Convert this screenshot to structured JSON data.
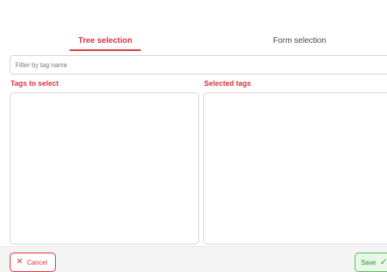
{
  "tabs": {
    "tree_label": "Tree selection",
    "form_label": "Form selection",
    "active": "tree"
  },
  "filter": {
    "placeholder": "Filter by tag name",
    "value": ""
  },
  "panels": {
    "left_label": "Tags to select",
    "right_label": "Selected tags"
  },
  "footer": {
    "cancel_label": "Cancel",
    "save_label": "Save"
  },
  "icons": {
    "cancel": "close-icon",
    "save": "check-icon"
  },
  "colors": {
    "accent": "#d9323a",
    "save_border": "#5cb85c",
    "save_bg": "#e8f8e8"
  }
}
